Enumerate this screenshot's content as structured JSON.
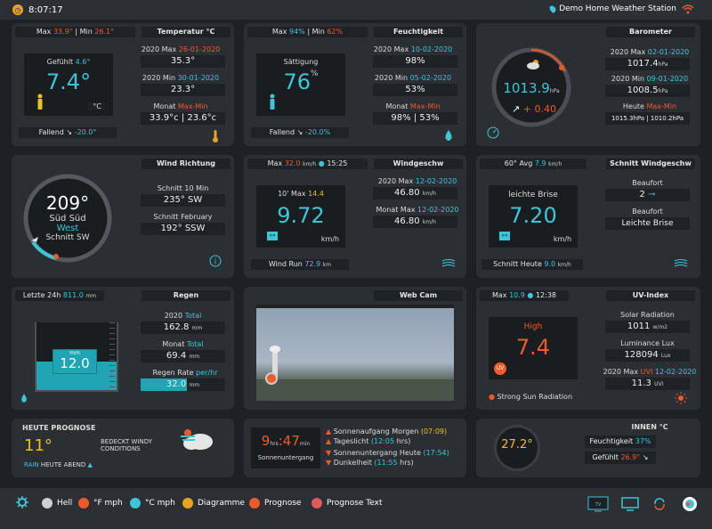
{
  "top": {
    "time": "8:07:17",
    "station": "Demo Home Weather Station"
  },
  "temp": {
    "max_label": "Max",
    "max_val": "33.9°",
    "min_label": "Min",
    "min_val": "26.1°",
    "title": "Temperatur °C",
    "feels_label": "Gefühlt",
    "feels_val": "4.6°",
    "current": "7.4°",
    "unit": "°C",
    "trend": "Fallend",
    "trend_val": "-20.0°",
    "year_max_label": "2020 Max",
    "year_max_date": "26-01-2020",
    "year_max_val": "35.3°",
    "year_min_label": "2020 Min",
    "year_min_date": "30-01-2020",
    "year_min_val": "23.3°",
    "month_label": "Monat",
    "month_maxmin": "Max-Min",
    "month_val": "33.9°c | 23.6°c"
  },
  "hum": {
    "max_label": "Max",
    "max_val": "94%",
    "min_label": "Min",
    "min_val": "62%",
    "title": "Feuchtigkeit",
    "sat_label": "Sättigung",
    "current": "76",
    "unit": "%",
    "trend": "Fallend",
    "trend_val": "-20.0%",
    "year_max_label": "2020 Max",
    "year_max_date": "10-02-2020",
    "year_max_val": "98%",
    "year_min_label": "2020 Min",
    "year_min_date": "05-02-2020",
    "year_min_val": "53%",
    "month_label": "Monat",
    "month_maxmin": "Max-Min",
    "month_val": "98% | 53%"
  },
  "baro": {
    "title": "Barometer",
    "current": "1013.9",
    "unit": "hPa",
    "change": "+ 0.40",
    "year_max_label": "2020 Max",
    "year_max_date": "02-01-2020",
    "year_max_val": "1017.4",
    "year_min_label": "2020 Min",
    "year_min_date": "09-01-2020",
    "year_min_val": "1008.5",
    "today_label": "Heute",
    "today_maxmin": "Max-Min",
    "today_val": "1015.3hPa | 1010.2hPa",
    "val_unit": "hPa"
  },
  "wind_dir": {
    "title": "Wind Richtung",
    "deg": "209°",
    "dir1": "Süd Süd",
    "dir2": "West",
    "avg": "Schnitt SW",
    "avg10_label": "Schnitt 10 Min",
    "avg10_val": "235°  SW",
    "avg_month_label": "Schnitt February",
    "avg_month_val": "192°  SSW"
  },
  "wind_speed": {
    "max_label": "Max",
    "max_val": "32.0",
    "max_unit": "km/h",
    "max_time": "15:25",
    "title": "Windgeschw",
    "tenmax_label": "10' Max",
    "tenmax_val": "14.4",
    "current": "9.72",
    "unit": "km/h",
    "run_label": "Wind Run",
    "run_val": "72.9",
    "run_unit": "km",
    "year_max_label": "2020 Max",
    "year_max_date": "12-02-2020",
    "year_max_val": "46.80",
    "month_max_label": "Monat Max",
    "month_max_date": "12-02-2020",
    "month_max_val": "46.80"
  },
  "gust": {
    "avg_label": "60° Avg",
    "avg_val": "7.9",
    "avg_unit": "km/h",
    "title": "Schnitt Windgeschw",
    "desc": "leichte Brise",
    "current": "7.20",
    "unit": "km/h",
    "today_label": "Schnitt Heute",
    "today_val": "9.0",
    "today_unit": "km/h",
    "beaufort_label": "Beaufort",
    "beaufort_val": "2",
    "beaufort2_label": "Beaufort",
    "beaufort2_val": "Leichte Brise"
  },
  "rain": {
    "last_label": "Letzte 24h",
    "last_val": "811.0",
    "last_unit": "mm",
    "title": "Regen",
    "current": "12.0",
    "unit": "mm",
    "level": 0.42,
    "year_label": "2020",
    "year_total": "Total",
    "year_val": "162.8",
    "month_label": "Monat",
    "month_total": "Total",
    "month_val": "69.4",
    "rate_label": "Regen Rate",
    "rate_unit_label": "per/hr",
    "rate_val": "32.0",
    "val_unit": "mm"
  },
  "webcam": {
    "title": "Web Cam"
  },
  "uv": {
    "max_label": "Max",
    "max_val": "10.9",
    "max_time": "12:38",
    "title": "UV-Index",
    "level": "High",
    "current": "7.4",
    "badge": "UV",
    "warning": "Strong Sun Radiation",
    "solar_label": "Solar Radiation",
    "solar_val": "1011",
    "solar_unit": "w/m2",
    "lux_label": "Luminance Lux",
    "lux_val": "128094",
    "lux_unit": "Lux",
    "year_label": "2020 Max",
    "year_uvi": "UVI",
    "year_date": "12-02-2020",
    "year_val": "11.3",
    "year_unit": "UVI"
  },
  "forecast": {
    "title": "HEUTE PROGNOSE",
    "temp": "11°",
    "desc": "BEDECKT WINDY CONDITIONS",
    "rain_label": "RAIN",
    "rain_rest": "HEUTE ABEND"
  },
  "sun": {
    "hours": "9",
    "hrs_label": "hrs",
    "mins": "47",
    "min_label": "min",
    "until_label": "Sonnenuntergang",
    "rise_label": "Sonnenaufgang Morgen",
    "rise_val": "(07:09)",
    "daylight_label": "Tageslicht",
    "daylight_val": "(12:05",
    "daylight_unit": "hrs)",
    "set_label": "Sonnenuntergang Heute",
    "set_val": "(17:54)",
    "dark_label": "Dunkelheit",
    "dark_val": "(11:55",
    "dark_unit": "hrs)"
  },
  "indoor": {
    "title": "INNEN °C",
    "temp": "27.2°",
    "hum_label": "Feuchtigkeit",
    "hum_val": "37%",
    "feels_label": "Gefühlt",
    "feels_val": "26.9°"
  },
  "legend": [
    {
      "label": "Hell",
      "color": "#cfcfcf"
    },
    {
      "label": "°F mph",
      "color": "#f05a28"
    },
    {
      "label": "°C mph",
      "color": "#3cc6d8"
    },
    {
      "label": "Diagramme",
      "color": "#e8a320"
    },
    {
      "label": "Prognose",
      "color": "#f05a28"
    },
    {
      "label": "Prognose Text",
      "color": "#e05a5a"
    }
  ],
  "colors": {
    "accent": "#3cc6d8",
    "orange": "#f05a28",
    "panel": "#2b2f34"
  }
}
